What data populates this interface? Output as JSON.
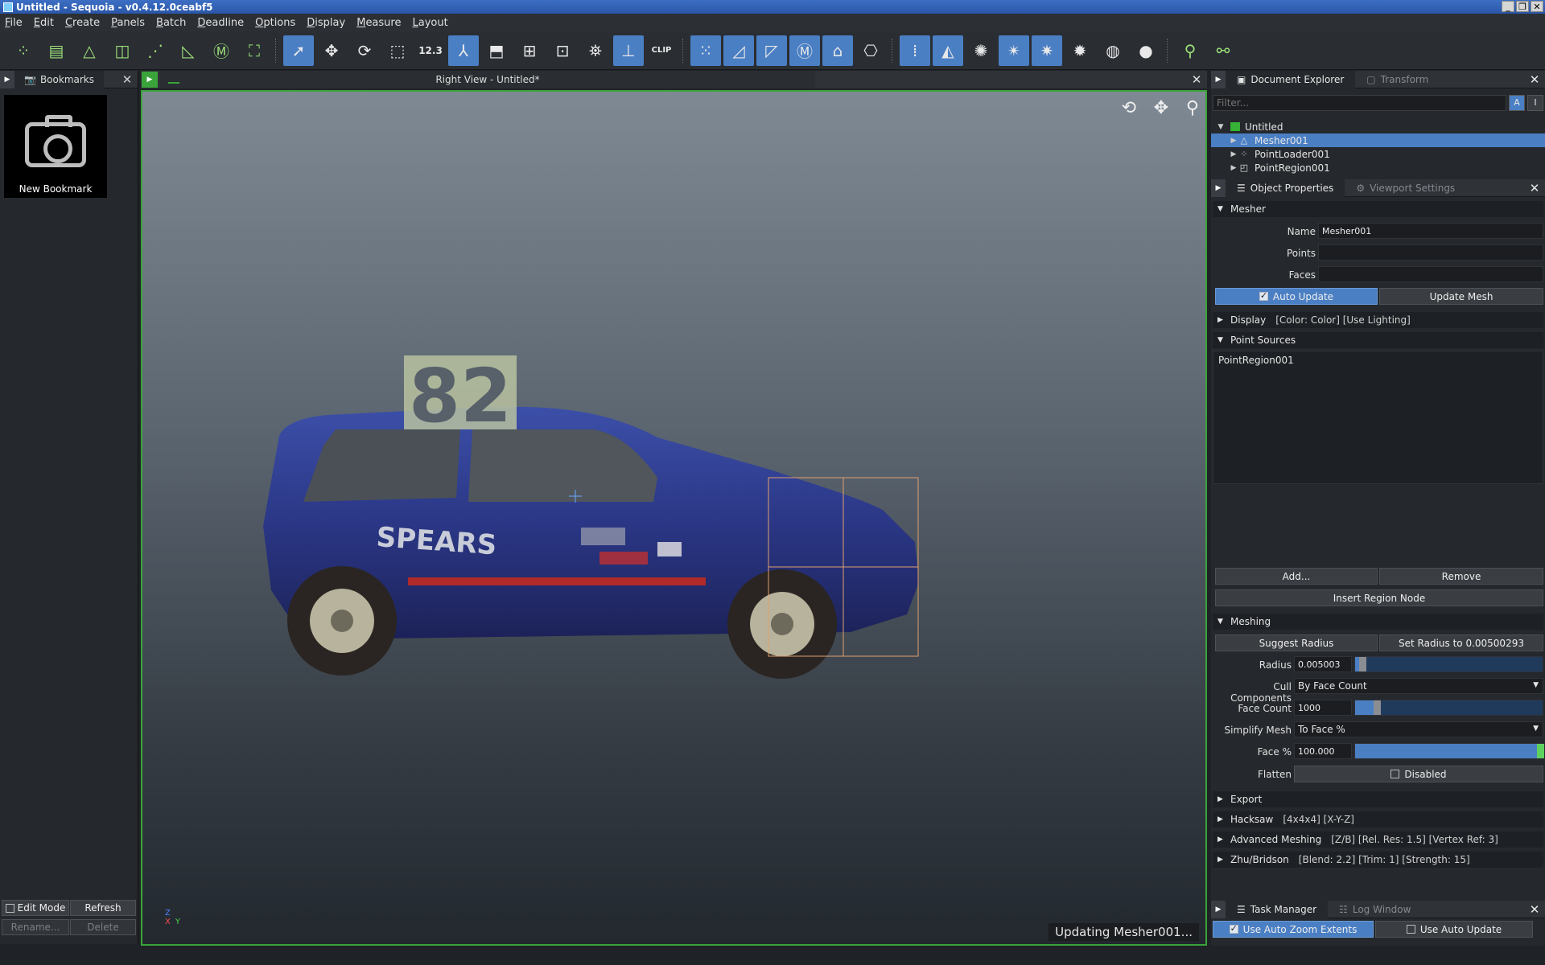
{
  "window": {
    "title": "Untitled - Sequoia - v0.4.12.0ceabf5"
  },
  "menu": [
    "File",
    "Edit",
    "Create",
    "Panels",
    "Batch",
    "Deadline",
    "Options",
    "Display",
    "Measure",
    "Layout"
  ],
  "toolbar": {
    "measure_label": "12.3",
    "clip_label": "CLIP"
  },
  "bookmarks": {
    "tab_label": "Bookmarks",
    "new_bookmark_label": "New Bookmark",
    "edit_mode_label": "Edit Mode",
    "refresh_label": "Refresh",
    "rename_label": "Rename...",
    "delete_label": "Delete"
  },
  "viewport": {
    "tab_title": "Right View - Untitled*",
    "car_number": "82",
    "car_text": "SPEARS",
    "status": "Updating  Mesher001...",
    "axis_z": "Z",
    "axis_y": "Y",
    "axis_x": "X"
  },
  "document_explorer": {
    "tab_label": "Document Explorer",
    "transform_tab_label": "Transform",
    "filter_placeholder": "Filter...",
    "root": "Untitled",
    "children": [
      "Mesher001",
      "PointLoader001",
      "PointRegion001"
    ]
  },
  "object_properties": {
    "tab_label": "Object Properties",
    "viewport_settings_tab_label": "Viewport Settings",
    "mesher_section": "Mesher",
    "name_label": "Name",
    "name_value": "Mesher001",
    "points_label": "Points",
    "faces_label": "Faces",
    "auto_update_label": "Auto Update",
    "update_mesh_label": "Update Mesh",
    "display_section": "Display",
    "display_summary": "[Color: Color] [Use Lighting]",
    "point_sources_section": "Point Sources",
    "point_sources": [
      "PointRegion001"
    ],
    "add_label": "Add...",
    "remove_label": "Remove",
    "insert_region_label": "Insert Region Node",
    "meshing_section": "Meshing",
    "suggest_radius_label": "Suggest Radius",
    "set_radius_label": "Set Radius to 0.00500293",
    "radius_label": "Radius",
    "radius_value": "0.005003",
    "radius_fraction": 0.02,
    "cull_label": "Cull Components",
    "cull_value": "By Face Count",
    "face_count_label": "Face Count",
    "face_count_value": "1000",
    "face_count_fraction": 0.1,
    "simplify_label": "Simplify Mesh",
    "simplify_value": "To Face %",
    "face_pct_label": "Face %",
    "face_pct_value": "100.000",
    "face_pct_fraction": 1.0,
    "flatten_label": "Flatten",
    "flatten_value": "Disabled",
    "export_section": "Export",
    "hacksaw_section": "Hacksaw",
    "hacksaw_summary": "[4x4x4] [X-Y-Z]",
    "advanced_section": "Advanced Meshing",
    "advanced_summary": "[Z/B] [Rel. Res: 1.5] [Vertex Ref: 3]",
    "zhu_section": "Zhu/Bridson",
    "zhu_summary": "[Blend: 2.2] [Trim: 1] [Strength: 15]"
  },
  "task_manager": {
    "tab_label": "Task Manager",
    "log_tab_label": "Log Window",
    "auto_zoom_label": "Use Auto Zoom Extents",
    "auto_update_label": "Use Auto Update"
  },
  "colors": {
    "accent": "#4a7fc4",
    "active_viewport": "#3aa43a",
    "region_box": "#e0a070"
  }
}
